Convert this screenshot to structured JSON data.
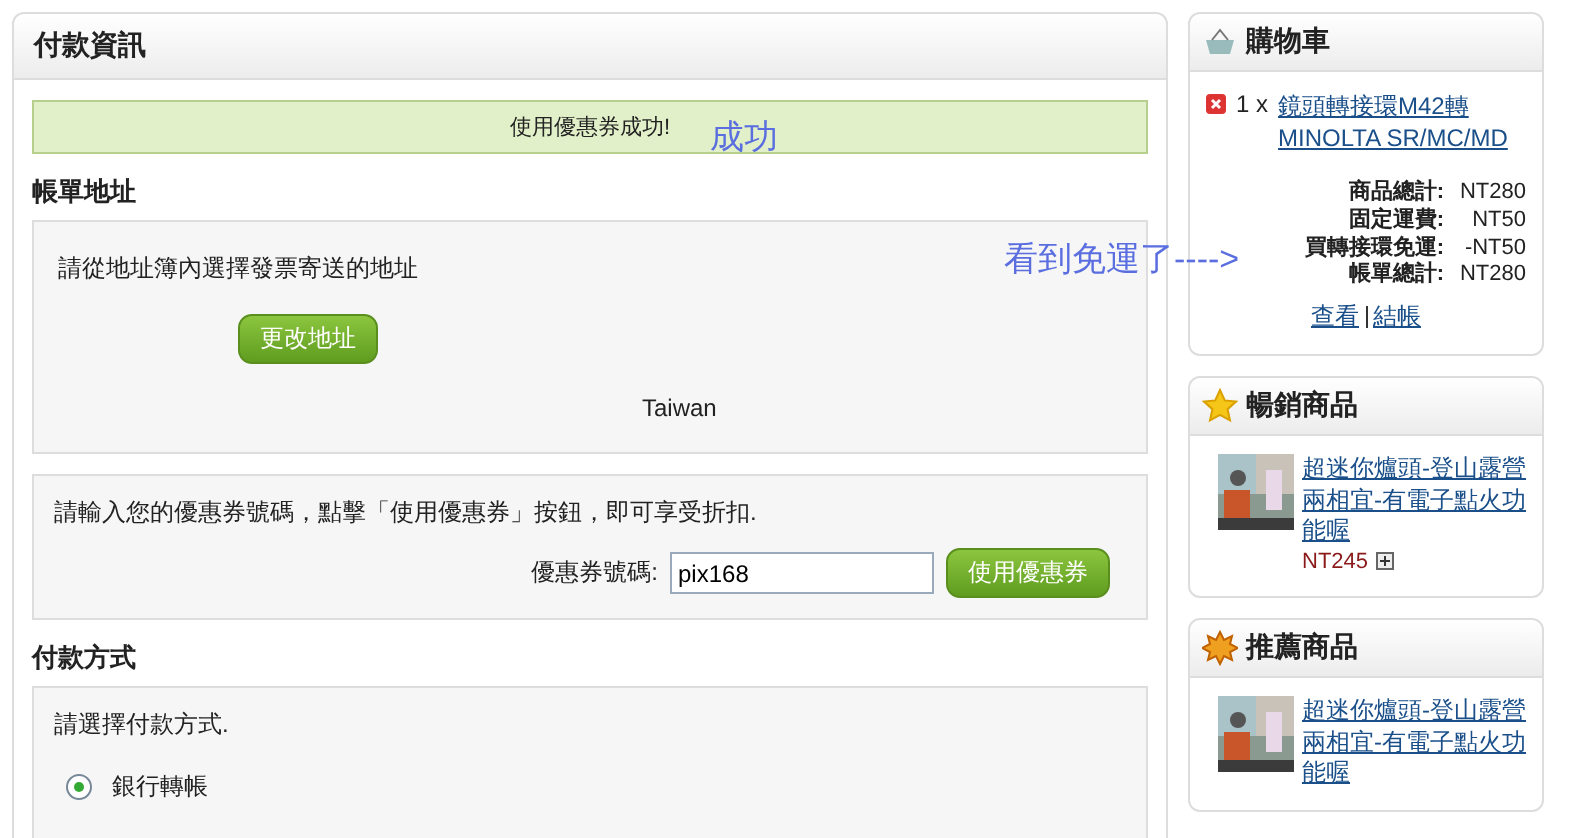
{
  "main": {
    "title": "付款資訊",
    "notice": "使用優惠券成功!",
    "billing": {
      "heading": "帳單地址",
      "instruction": "請從地址簿內選擇發票寄送的地址",
      "button": "更改地址",
      "address_lines": [
        "Taiwan"
      ]
    },
    "coupon": {
      "instruction": "請輸入您的優惠券號碼，點擊「使用優惠券」按鈕，即可享受折扣.",
      "label": "優惠券號碼:",
      "value": "pix168",
      "button": "使用優惠券"
    },
    "payment": {
      "heading": "付款方式",
      "instruction": "請選擇付款方式.",
      "options": [
        {
          "label": "銀行轉帳",
          "selected": true
        }
      ]
    }
  },
  "annotations": [
    {
      "text": "成功"
    },
    {
      "text": "看到免運了---->"
    }
  ],
  "cart": {
    "title": "購物車",
    "items": [
      {
        "qty": "1 x",
        "name": "鏡頭轉接環M42轉MINOLTA SR/MC/MD"
      }
    ],
    "totals": [
      {
        "label": "商品總計:",
        "value": "NT280"
      },
      {
        "label": "固定運費:",
        "value": "NT50"
      },
      {
        "label": "買轉接環免運:",
        "value": "-NT50"
      },
      {
        "label": "帳單總計:",
        "value": "NT280"
      }
    ],
    "links": [
      "查看",
      "結帳"
    ]
  },
  "boxes": [
    {
      "kind": "star",
      "title": "暢銷商品",
      "products": [
        {
          "name": "超迷你爐頭-登山露營兩相宜-有電子點火功能喔",
          "price": "NT245"
        }
      ]
    },
    {
      "kind": "burst",
      "title": "推薦商品",
      "products": [
        {
          "name": "超迷你爐頭-登山露營兩相宜-有電子點火功能喔"
        }
      ]
    }
  ]
}
